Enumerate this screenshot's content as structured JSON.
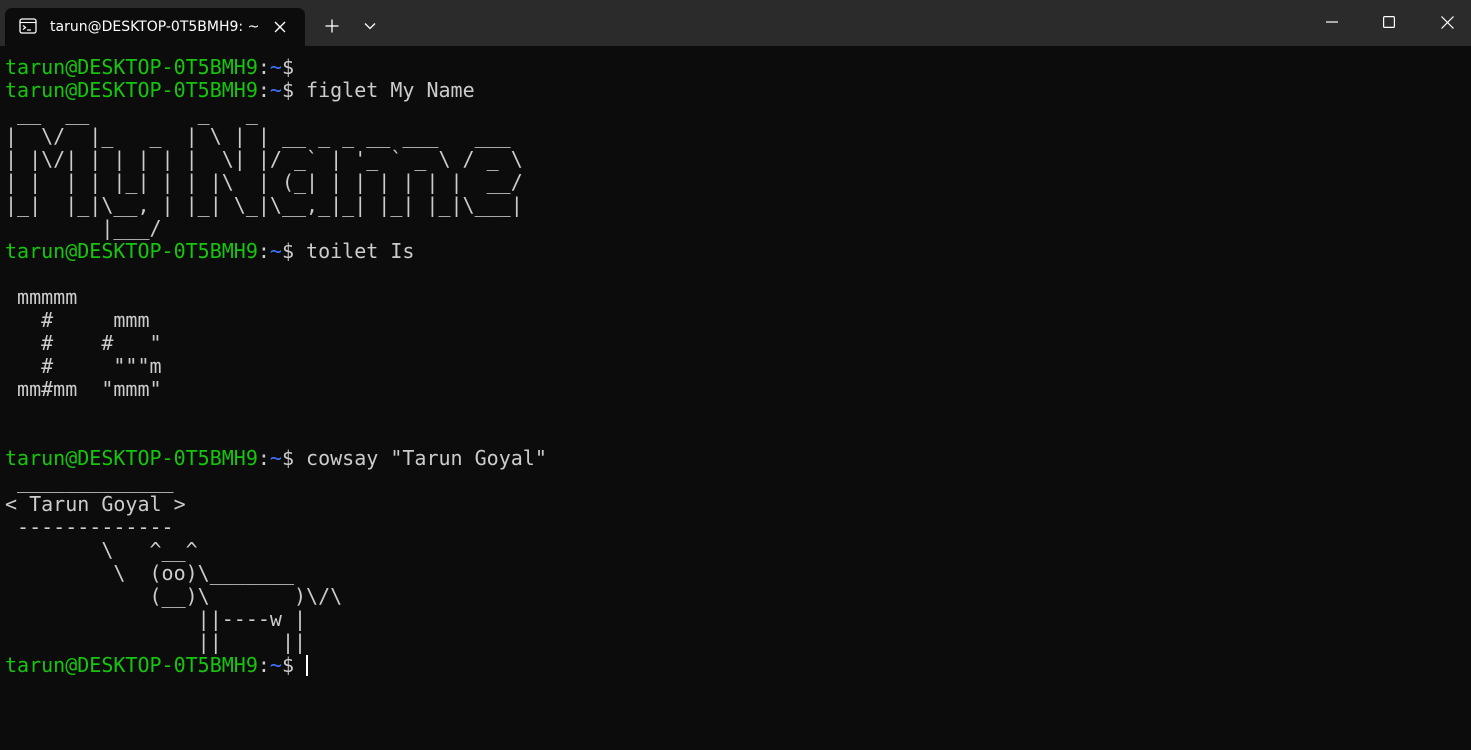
{
  "window": {
    "tab_title": "tarun@DESKTOP-0T5BMH9: ~"
  },
  "prompt": {
    "user_host": "tarun@DESKTOP-0T5BMH9",
    "separator": ":",
    "path": "~",
    "symbol": "$"
  },
  "commands": {
    "cmd1": " figlet My Name",
    "cmd2": " toilet Is",
    "cmd3": " cowsay \"Tarun Goyal\""
  },
  "output": {
    "figlet": [
      " __  __         _   _",
      "|  \\/  |_   _  | \\ | | __ _ _ __ ___   ___",
      "| |\\/| | | | | |  \\| |/ _` | '_ ` _ \\ / _ \\",
      "| |  | | |_| | | |\\  | (_| | | | | | |  __/",
      "|_|  |_|\\__, | |_| \\_|\\__,_|_| |_| |_|\\___|",
      "        |___/"
    ],
    "toilet": [
      " mmmmm",
      "   #     mmm",
      "   #    #   \"",
      "   #     \"\"\"m",
      " mm#mm  \"mmm\""
    ],
    "cowsay": [
      " _____________",
      "< Tarun Goyal >",
      " -------------",
      "        \\   ^__^",
      "         \\  (oo)\\_______",
      "            (__)\\       )\\/\\",
      "                ||----w |",
      "                ||     ||"
    ]
  },
  "colors": {
    "background": "#0c0c0c",
    "titlebar": "#2b2b2b",
    "user_host": "#16c60c",
    "path": "#3b78ff",
    "text": "#cccccc"
  },
  "icons": {
    "tab_icon": "terminal-icon",
    "tab_close": "close-icon",
    "new_tab": "plus-icon",
    "dropdown": "chevron-down-icon",
    "minimize": "minimize-icon",
    "maximize": "maximize-icon",
    "close": "close-icon"
  }
}
